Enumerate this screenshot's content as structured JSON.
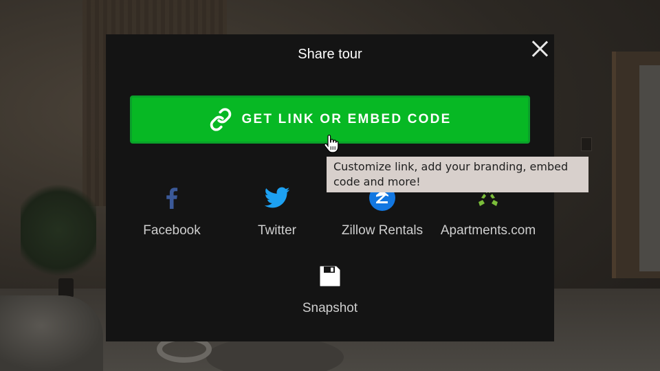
{
  "modal": {
    "title": "Share tour",
    "close_icon": "close-icon"
  },
  "primary_action": {
    "label": "GET LINK OR EMBED CODE",
    "icon": "link-icon",
    "color": "#07b824"
  },
  "tooltip": {
    "text": "Customize link, add your branding, embed code and more!"
  },
  "share_targets": [
    {
      "label": "Facebook",
      "icon": "facebook-icon",
      "color": "#3b5998"
    },
    {
      "label": "Twitter",
      "icon": "twitter-icon",
      "color": "#1da1f2"
    },
    {
      "label": "Zillow Rentals",
      "icon": "zillow-icon",
      "color": "#1277e1"
    },
    {
      "label": "Apartments.com",
      "icon": "apartments-com-icon",
      "color": "#7bbd3a"
    }
  ],
  "snapshot": {
    "label": "Snapshot",
    "icon": "floppy-disk-icon"
  }
}
